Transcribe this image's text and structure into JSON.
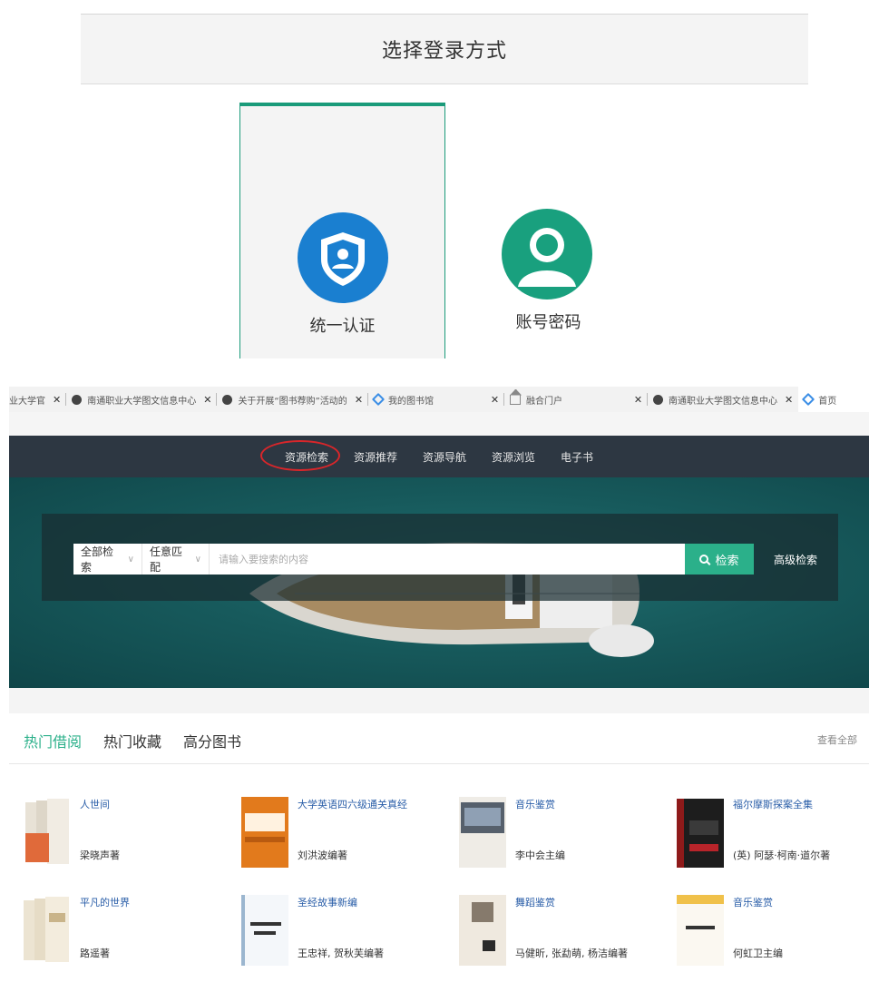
{
  "login": {
    "title": "选择登录方式",
    "options": [
      {
        "label": "统一认证",
        "icon": "shield-user-icon",
        "selected": true
      },
      {
        "label": "账号密码",
        "icon": "user-avatar-icon",
        "selected": false
      }
    ]
  },
  "browser_tabs": [
    {
      "title": "业大学官",
      "icon": "page-icon"
    },
    {
      "title": "南通职业大学图文信息中心",
      "icon": "globe-icon"
    },
    {
      "title": "关于开展“图书荐购”活动的",
      "icon": "globe-icon"
    },
    {
      "title": "我的图书馆",
      "icon": "diamond-icon"
    },
    {
      "title": "融合门户",
      "icon": "home-icon"
    },
    {
      "title": "南通职业大学图文信息中心",
      "icon": "globe-icon"
    },
    {
      "title": "首页",
      "icon": "diamond-icon",
      "active": true
    }
  ],
  "nav": {
    "items": [
      "资源检索",
      "资源推荐",
      "资源导航",
      "资源浏览",
      "电子书"
    ],
    "circled_index": 0
  },
  "search": {
    "scope": "全部检索",
    "match": "任意匹配",
    "placeholder": "请输入要搜索的内容",
    "button": "检索",
    "advanced": "高级检索"
  },
  "books": {
    "tabs": [
      "热门借阅",
      "热门收藏",
      "高分图书"
    ],
    "active_tab": 0,
    "view_all": "查看全部",
    "items": [
      {
        "title": "人世间",
        "author": "梁晓声著"
      },
      {
        "title": "大学英语四六级通关真经",
        "author": "刘洪波编著"
      },
      {
        "title": "音乐鉴赏",
        "author": "李中会主编"
      },
      {
        "title": "福尔摩斯探案全集",
        "author": "(英) 阿瑟·柯南·道尔著"
      },
      {
        "title": "平凡的世界",
        "author": "路遥著"
      },
      {
        "title": "圣经故事新编",
        "author": "王忠祥, 贺秋芙编著"
      },
      {
        "title": "舞蹈鉴赏",
        "author": "马健昕, 张勐萌, 杨洁编著"
      },
      {
        "title": "音乐鉴赏",
        "author": "何虹卫主编"
      }
    ]
  },
  "colors": {
    "accent": "#2bb08a",
    "nav_bg": "#2d3742",
    "unified_blue": "#1a7fd0",
    "link_blue": "#2a5ea8",
    "circle_red": "#d9262a"
  }
}
